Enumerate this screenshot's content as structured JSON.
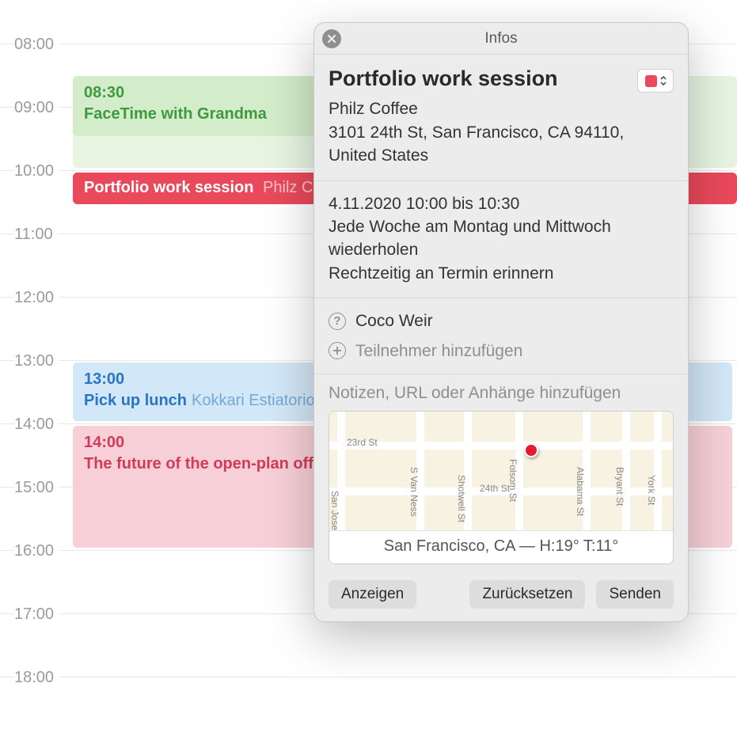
{
  "calendar": {
    "hours": [
      "08:00",
      "09:00",
      "10:00",
      "11:00",
      "12:00",
      "13:00",
      "14:00",
      "15:00",
      "16:00",
      "17:00",
      "18:00"
    ],
    "events": [
      {
        "time": "08:30",
        "title": "FaceTime with Grandma",
        "loc": ""
      },
      {
        "time": "",
        "title": "Portfolio work session",
        "loc": "Philz Coffee"
      },
      {
        "time": "13:00",
        "title": "Pick up lunch",
        "loc": "Kokkari Estiatorio"
      },
      {
        "time": "14:00",
        "title": "The future of the open-plan office",
        "loc": ""
      }
    ]
  },
  "popover": {
    "header": "Infos",
    "title": "Portfolio work session",
    "location_name": "Philz Coffee",
    "location_addr": "3101 24th St, San Francisco, CA 94110, United States",
    "date_line": "4.11.2020  10:00 bis 10:30",
    "repeat_line": "Jede Woche am Montag und Mittwoch wiederholen",
    "alert_line": "Rechtzeitig an Termin erinnern",
    "invitee": "Coco Weir",
    "add_invitee": "Teilnehmer hinzufügen",
    "notes_placeholder": "Notizen, URL oder Anhänge hinzufügen",
    "map": {
      "streets_h": [
        "23rd St",
        "24th St"
      ],
      "streets_v": [
        "San Jose",
        "S Van Ness",
        "Shotwell St",
        "Folsom St",
        "Alabama St",
        "Bryant St",
        "York St"
      ],
      "caption": "San Francisco, CA — H:19° T:11°",
      "pin_color": "#e41b2e"
    },
    "buttons": {
      "show": "Anzeigen",
      "reset": "Zurücksetzen",
      "send": "Senden"
    },
    "calendar_color": "#e9495b"
  }
}
